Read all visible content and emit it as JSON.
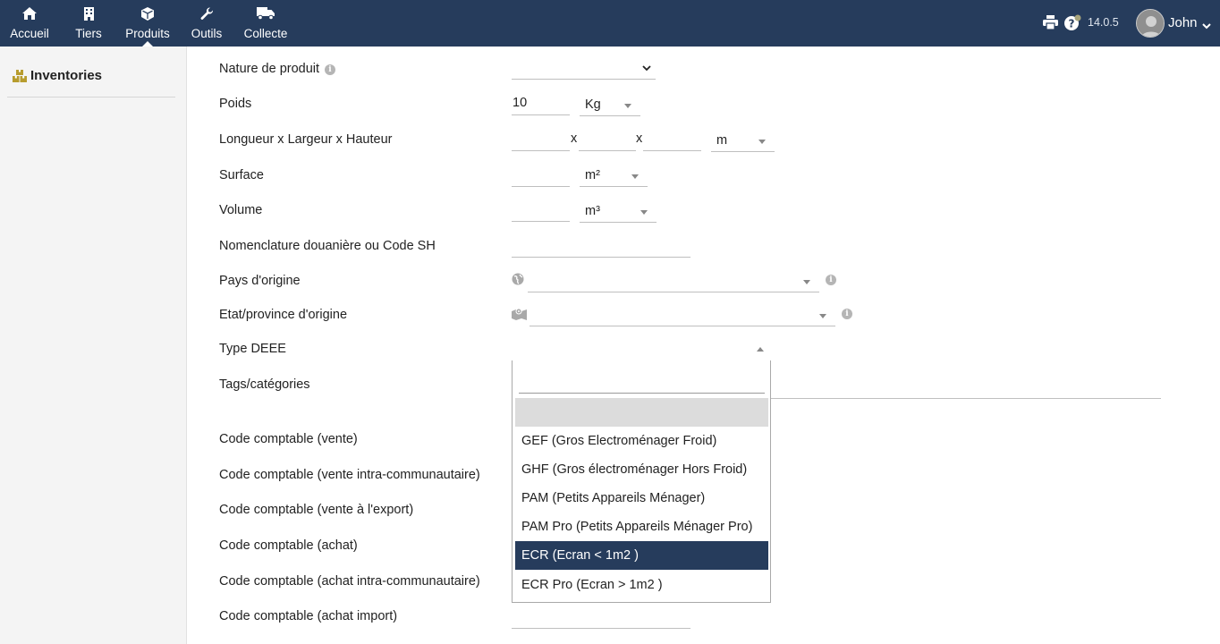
{
  "topbar": {
    "nav": [
      {
        "label": "Accueil",
        "icon": "home-icon"
      },
      {
        "label": "Tiers",
        "icon": "building-icon"
      },
      {
        "label": "Produits",
        "icon": "cube-icon"
      },
      {
        "label": "Outils",
        "icon": "wrench-icon"
      },
      {
        "label": "Collecte",
        "icon": "truck-icon"
      }
    ],
    "active_nav": "Produits",
    "version": "14.0.5",
    "user": "John"
  },
  "sidebar": {
    "title": "Inventories"
  },
  "form": {
    "nature_label": "Nature de produit",
    "poids_label": "Poids",
    "poids_value": "10",
    "poids_unit": "Kg",
    "dims_label": "Longueur x Largeur x Hauteur",
    "dims_sep": "x",
    "dims_unit": "m",
    "surface_label": "Surface",
    "surface_unit": "m²",
    "volume_label": "Volume",
    "volume_unit": "m³",
    "nomenclature_label": "Nomenclature douanière ou Code SH",
    "pays_label": "Pays d'origine",
    "etat_label": "Etat/province d'origine",
    "deee_label": "Type DEEE",
    "tags_label": "Tags/catégories",
    "cc_vente": "Code comptable (vente)",
    "cc_vente_intra": "Code comptable (vente intra-communautaire)",
    "cc_vente_export": "Code comptable (vente à l'export)",
    "cc_achat": "Code comptable (achat)",
    "cc_achat_intra": "Code comptable (achat intra-communautaire)",
    "cc_achat_import": "Code comptable (achat import)"
  },
  "deee_dropdown": {
    "options": [
      "",
      "GEF (Gros Electroménager Froid)",
      "GHF (Gros électroménager Hors Froid)",
      "PAM (Petits Appareils Ménager)",
      "PAM Pro (Petits Appareils Ménager Pro)",
      "ECR (Ecran < 1m2 )",
      "ECR Pro (Ecran > 1m2 )"
    ],
    "highlighted": "ECR (Ecran < 1m2 )"
  },
  "colors": {
    "topbar_bg": "#263c5c",
    "highlight_bg": "#263c5c",
    "inventory_icon": "#b79c2e"
  }
}
